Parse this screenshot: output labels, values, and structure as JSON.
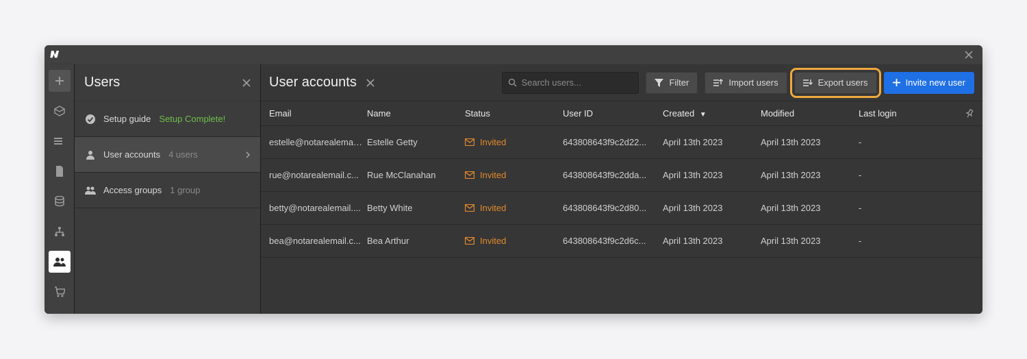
{
  "sidebar": {
    "title": "Users",
    "items": [
      {
        "label": "Setup guide",
        "meta": "Setup Complete!"
      },
      {
        "label": "User accounts",
        "meta": "4 users"
      },
      {
        "label": "Access groups",
        "meta": "1 group"
      }
    ]
  },
  "main": {
    "title": "User accounts",
    "search_placeholder": "Search users...",
    "filter_label": "Filter",
    "import_label": "Import users",
    "export_label": "Export users",
    "invite_label": "Invite new user"
  },
  "table": {
    "headers": {
      "email": "Email",
      "name": "Name",
      "status": "Status",
      "user_id": "User ID",
      "created": "Created",
      "modified": "Modified",
      "last_login": "Last login"
    },
    "rows": [
      {
        "email": "estelle@notarealemail...",
        "name": "Estelle Getty",
        "status": "Invited",
        "user_id": "643808643f9c2d22...",
        "created": "April 13th 2023",
        "modified": "April 13th 2023",
        "last_login": "-"
      },
      {
        "email": "rue@notarealemail.c...",
        "name": "Rue McClanahan",
        "status": "Invited",
        "user_id": "643808643f9c2dda...",
        "created": "April 13th 2023",
        "modified": "April 13th 2023",
        "last_login": "-"
      },
      {
        "email": "betty@notarealemail....",
        "name": "Betty White",
        "status": "Invited",
        "user_id": "643808643f9c2d80...",
        "created": "April 13th 2023",
        "modified": "April 13th 2023",
        "last_login": "-"
      },
      {
        "email": "bea@notarealemail.c...",
        "name": "Bea Arthur",
        "status": "Invited",
        "user_id": "643808643f9c2d6c...",
        "created": "April 13th 2023",
        "modified": "April 13th 2023",
        "last_login": "-"
      }
    ]
  }
}
